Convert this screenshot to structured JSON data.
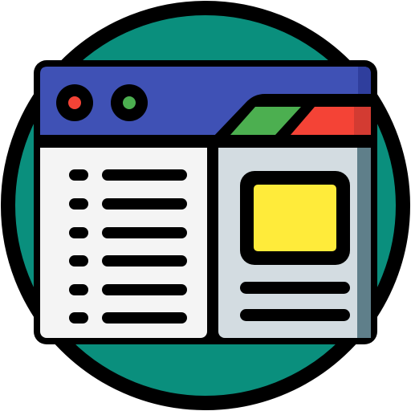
{
  "icon": {
    "name": "browser-window-layout-icon",
    "colors": {
      "outline": "#000000",
      "circle_background": "#0a8f7d",
      "title_bar": "#3f51b5",
      "title_bar_shadow": "#2f3e9d",
      "left_panel": "#f4f4f4",
      "right_panel": "#d3dce1",
      "right_panel_shadow": "#5f7f8a",
      "image_placeholder": "#ffeb3a",
      "tab_green": "#4caf50",
      "tab_red": "#f44336",
      "tab_red_dark": "#d33b32",
      "window_close_dot": "#f44336",
      "window_minimize_dot": "#4caf50"
    },
    "left_list_items": 6,
    "right_text_lines": 2
  }
}
